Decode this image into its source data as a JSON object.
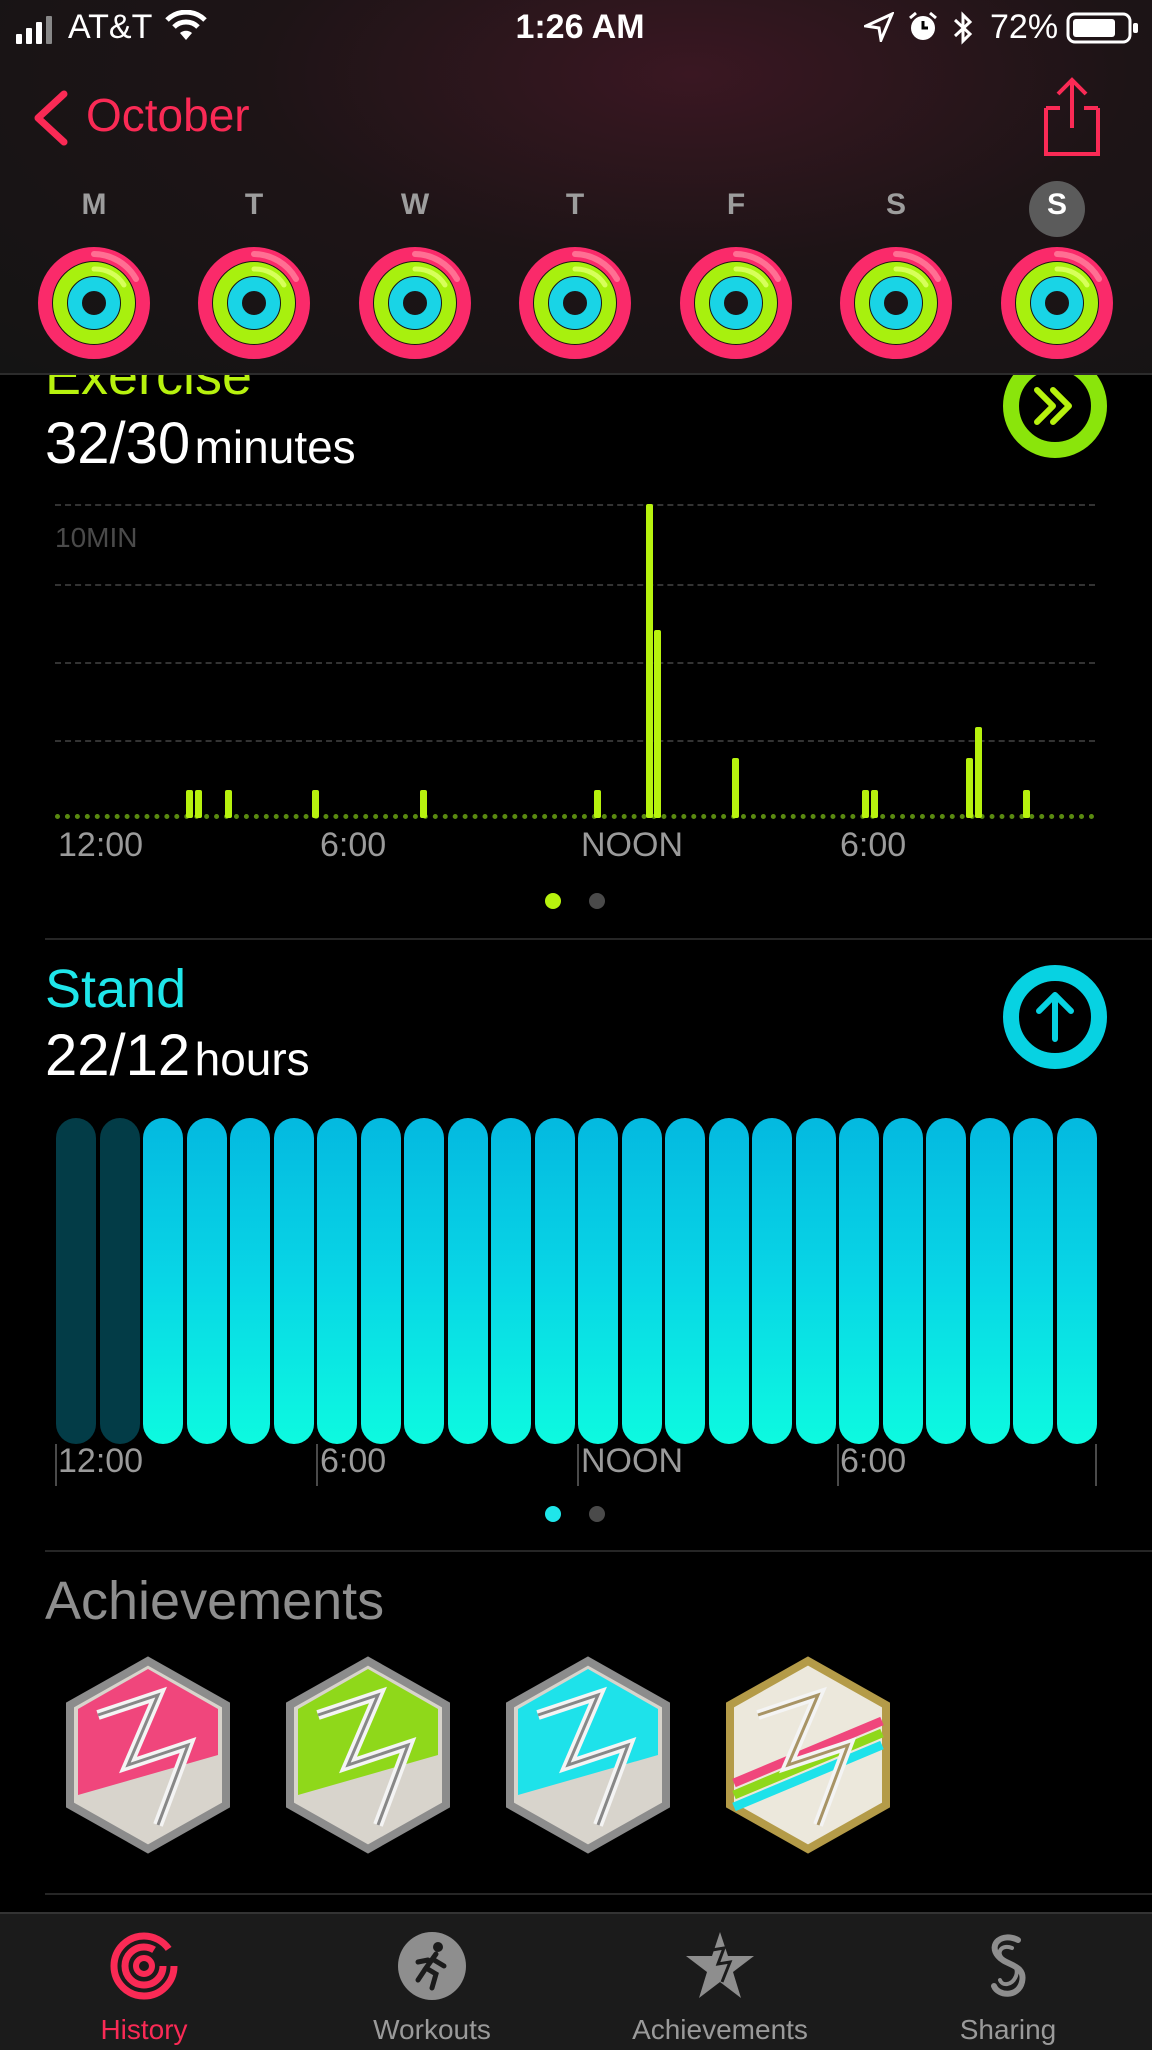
{
  "status_bar": {
    "carrier": "AT&T",
    "time": "1:26 AM",
    "battery": "72%"
  },
  "header": {
    "back_label": "October",
    "share_icon": "share-icon"
  },
  "week": {
    "days": [
      {
        "letter": "M",
        "selected": false
      },
      {
        "letter": "T",
        "selected": false
      },
      {
        "letter": "W",
        "selected": false
      },
      {
        "letter": "T",
        "selected": false
      },
      {
        "letter": "F",
        "selected": false
      },
      {
        "letter": "S",
        "selected": false
      },
      {
        "letter": "S",
        "selected": true
      }
    ]
  },
  "exercise": {
    "title": "Exercise",
    "value": "32/30",
    "unit": "minutes",
    "grid_label": "10MIN",
    "x_ticks": [
      "12:00",
      "6:00",
      "NOON",
      "6:00"
    ],
    "colors": {
      "bar": "#b7f20e"
    }
  },
  "stand": {
    "title": "Stand",
    "value": "22/12",
    "unit": "hours",
    "x_ticks": [
      "12:00",
      "6:00",
      "NOON",
      "6:00"
    ],
    "colors": {
      "bar": "#0de4e6",
      "off": "#033c47"
    }
  },
  "achievements": {
    "title": "Achievements",
    "badges": [
      "move-badge",
      "exercise-badge",
      "stand-badge",
      "all-rings-badge"
    ]
  },
  "tabs": [
    {
      "label": "History",
      "icon": "history-icon",
      "active": true
    },
    {
      "label": "Workouts",
      "icon": "workouts-icon",
      "active": false
    },
    {
      "label": "Achievements",
      "icon": "achievements-icon",
      "active": false
    },
    {
      "label": "Sharing",
      "icon": "sharing-icon",
      "active": false
    }
  ],
  "chart_data": [
    {
      "type": "bar",
      "title": "Exercise",
      "xlabel": "",
      "ylabel": "",
      "x_tick_labels": [
        "12:00",
        "6:00",
        "NOON",
        "6:00"
      ],
      "x": [
        3.1,
        3.3,
        4.0,
        6.0,
        8.5,
        12.5,
        13.7,
        13.9,
        15.7,
        18.7,
        18.9,
        21.1,
        21.3,
        22.4
      ],
      "values": [
        0.9,
        0.9,
        0.9,
        0.9,
        0.9,
        0.9,
        10,
        6.0,
        1.9,
        0.9,
        0.9,
        1.9,
        2.9,
        0.9
      ],
      "ylim": [
        0,
        10
      ],
      "unit": "MIN"
    },
    {
      "type": "bar",
      "title": "Stand",
      "xlabel": "",
      "ylabel": "",
      "x_tick_labels": [
        "12:00",
        "6:00",
        "NOON",
        "6:00"
      ],
      "categories": [
        0,
        1,
        2,
        3,
        4,
        5,
        6,
        7,
        8,
        9,
        10,
        11,
        12,
        13,
        14,
        15,
        16,
        17,
        18,
        19,
        20,
        21,
        22,
        23
      ],
      "values": [
        0,
        0,
        1,
        1,
        1,
        1,
        1,
        1,
        1,
        1,
        1,
        1,
        1,
        1,
        1,
        1,
        1,
        1,
        1,
        1,
        1,
        1,
        1,
        1
      ]
    }
  ]
}
